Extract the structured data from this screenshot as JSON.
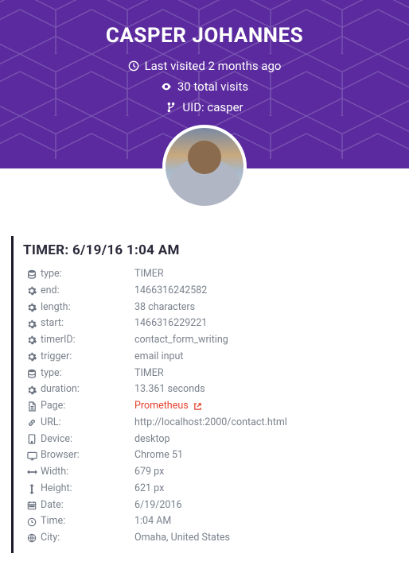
{
  "hero": {
    "name": "CASPER JOHANNES",
    "last_visited": "Last visited 2 months ago",
    "total_visits": "30 total visits",
    "uid": "UID: casper"
  },
  "panel": {
    "title": "TIMER: 6/19/16 1:04 AM",
    "page_link_text": "Prometheus",
    "rows": [
      {
        "icon": "db",
        "label": "type:",
        "value": "TIMER"
      },
      {
        "icon": "gear",
        "label": "end:",
        "value": "1466316242582"
      },
      {
        "icon": "gear",
        "label": "length:",
        "value": "38 characters"
      },
      {
        "icon": "gear",
        "label": "start:",
        "value": "1466316229221"
      },
      {
        "icon": "gear",
        "label": "timerID:",
        "value": "contact_form_writing"
      },
      {
        "icon": "gear",
        "label": "trigger:",
        "value": "email input"
      },
      {
        "icon": "db",
        "label": "type:",
        "value": "TIMER"
      },
      {
        "icon": "gear",
        "label": "duration:",
        "value": "13.361 seconds"
      },
      {
        "icon": "file",
        "label": "Page:",
        "value": "Prometheus",
        "link": true
      },
      {
        "icon": "link",
        "label": "URL:",
        "value": "http://localhost:2000/contact.html"
      },
      {
        "icon": "mobile",
        "label": "Device:",
        "value": "desktop"
      },
      {
        "icon": "desktop",
        "label": "Browser:",
        "value": "Chrome 51"
      },
      {
        "icon": "arrows-h",
        "label": "Width:",
        "value": "679 px"
      },
      {
        "icon": "arrows-v",
        "label": "Height:",
        "value": "621 px"
      },
      {
        "icon": "calendar",
        "label": "Date:",
        "value": "6/19/2016"
      },
      {
        "icon": "clock",
        "label": "Time:",
        "value": "1:04 AM"
      },
      {
        "icon": "globe",
        "label": "City:",
        "value": "Omaha, United States"
      }
    ]
  }
}
